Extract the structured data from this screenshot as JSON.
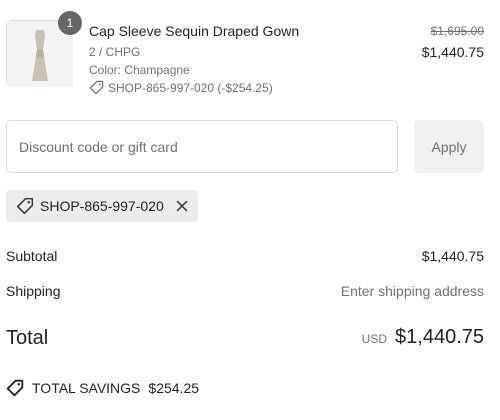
{
  "product": {
    "quantity": "1",
    "title": "Cap Sleeve Sequin Draped Gown",
    "variant": "2 / CHPG",
    "color": "Color: Champagne",
    "discount_note": "SHOP-865-997-020 (-$254.25)",
    "original_price": "$1,695.00",
    "price": "$1,440.75",
    "image_icon": "dress-thumbnail"
  },
  "discount": {
    "placeholder": "Discount code or gift card",
    "value": "",
    "apply_label": "Apply",
    "applied_code": "SHOP-865-997-020",
    "tag_icon": "tag-icon",
    "remove_icon": "close-icon"
  },
  "summary": {
    "subtotal_label": "Subtotal",
    "subtotal_value": "$1,440.75",
    "shipping_label": "Shipping",
    "shipping_value": "Enter shipping address",
    "total_label": "Total",
    "currency": "USD",
    "total_value": "$1,440.75"
  },
  "savings": {
    "label": "TOTAL SAVINGS",
    "value": "$254.25",
    "icon": "tag-icon"
  },
  "colors": {
    "badge": "#666666",
    "muted_text": "#707070",
    "border": "#d9d9d9",
    "chip_bg": "#ececec"
  }
}
